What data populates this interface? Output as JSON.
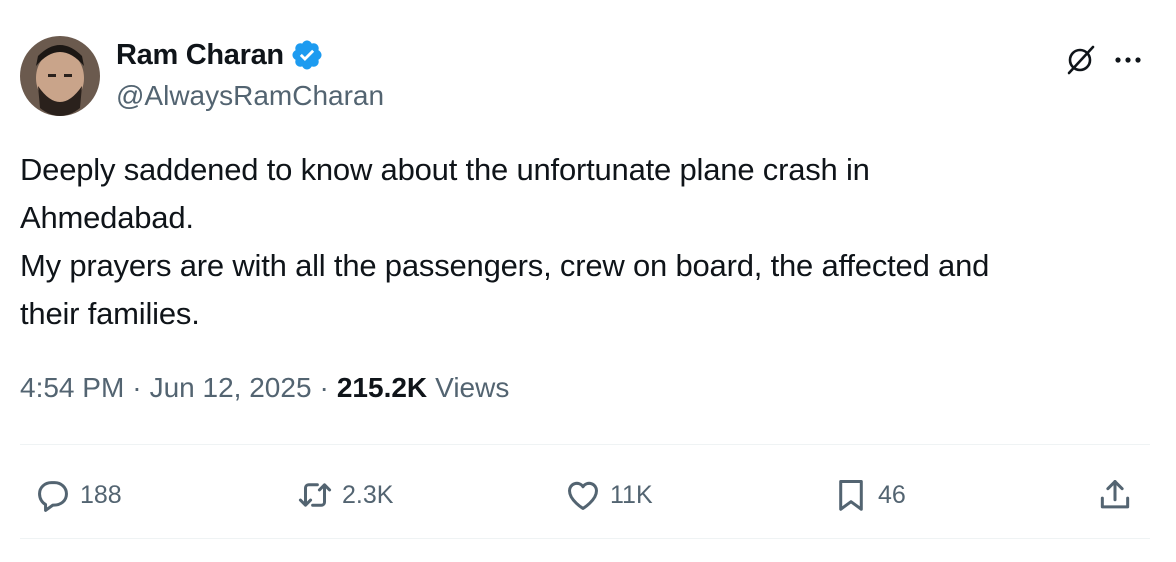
{
  "author": {
    "name": "Ram Charan",
    "handle": "@AlwaysRamCharan",
    "verified": true,
    "verified_color": "#1d9bf0"
  },
  "post": {
    "text": "Deeply saddened to know about the unfortunate plane crash in\nAhmedabad.\nMy prayers are with all the passengers, crew on board, the affected and\ntheir families.",
    "time": "4:54 PM",
    "date": "Jun 12, 2025",
    "separator": "·",
    "views_count": "215.2K",
    "views_label": "Views"
  },
  "actions": {
    "replies": "188",
    "reposts": "2.3K",
    "likes": "11K",
    "bookmarks": "46"
  },
  "icons": [
    "grok-icon",
    "more-icon",
    "reply-icon",
    "repost-icon",
    "like-icon",
    "bookmark-icon",
    "share-icon",
    "verified-badge-icon"
  ],
  "colors": {
    "text": "#0f1419",
    "secondary": "#536471",
    "divider": "#eff3f4"
  }
}
